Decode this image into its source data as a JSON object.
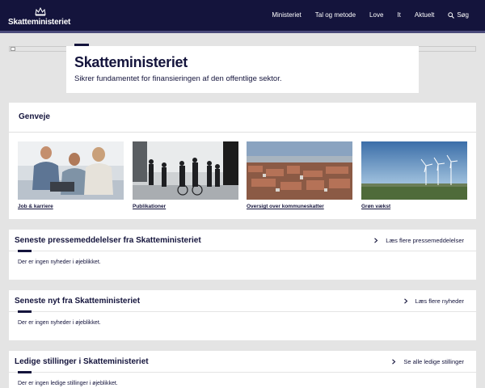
{
  "header": {
    "logo_text": "Skatteministeriet",
    "nav": [
      {
        "label": "Ministeriet"
      },
      {
        "label": "Tal og metode"
      },
      {
        "label": "Love"
      },
      {
        "label": "It"
      },
      {
        "label": "Aktuelt"
      }
    ],
    "search_label": "Søg"
  },
  "hero": {
    "title": "Skatteministeriet",
    "subtitle": "Sikrer fundamentet for finansieringen af den offentlige sektor."
  },
  "shortcuts": {
    "title": "Genveje",
    "tiles": [
      {
        "label": "Job & karriere"
      },
      {
        "label": "Publikationer"
      },
      {
        "label": "Oversigt over kommuneskatter"
      },
      {
        "label": "Grøn vækst"
      }
    ]
  },
  "press": {
    "title": "Seneste pressemeddelelser fra Skatteministeriet",
    "more": "Læs flere pressemeddelelser",
    "empty": "Der er ingen nyheder i øjeblikket."
  },
  "news": {
    "title": "Seneste nyt fra Skatteministeriet",
    "more": "Læs flere nyheder",
    "empty": "Der er ingen nyheder i øjeblikket."
  },
  "jobs": {
    "title": "Ledige stillinger i Skatteministeriet",
    "more": "Se alle ledige stillinger",
    "empty": "Der er ingen ledige stillinger i øjeblikket."
  },
  "colors": {
    "brand_navy": "#14143c",
    "background": "#e4e4e4",
    "panel": "#ffffff"
  }
}
